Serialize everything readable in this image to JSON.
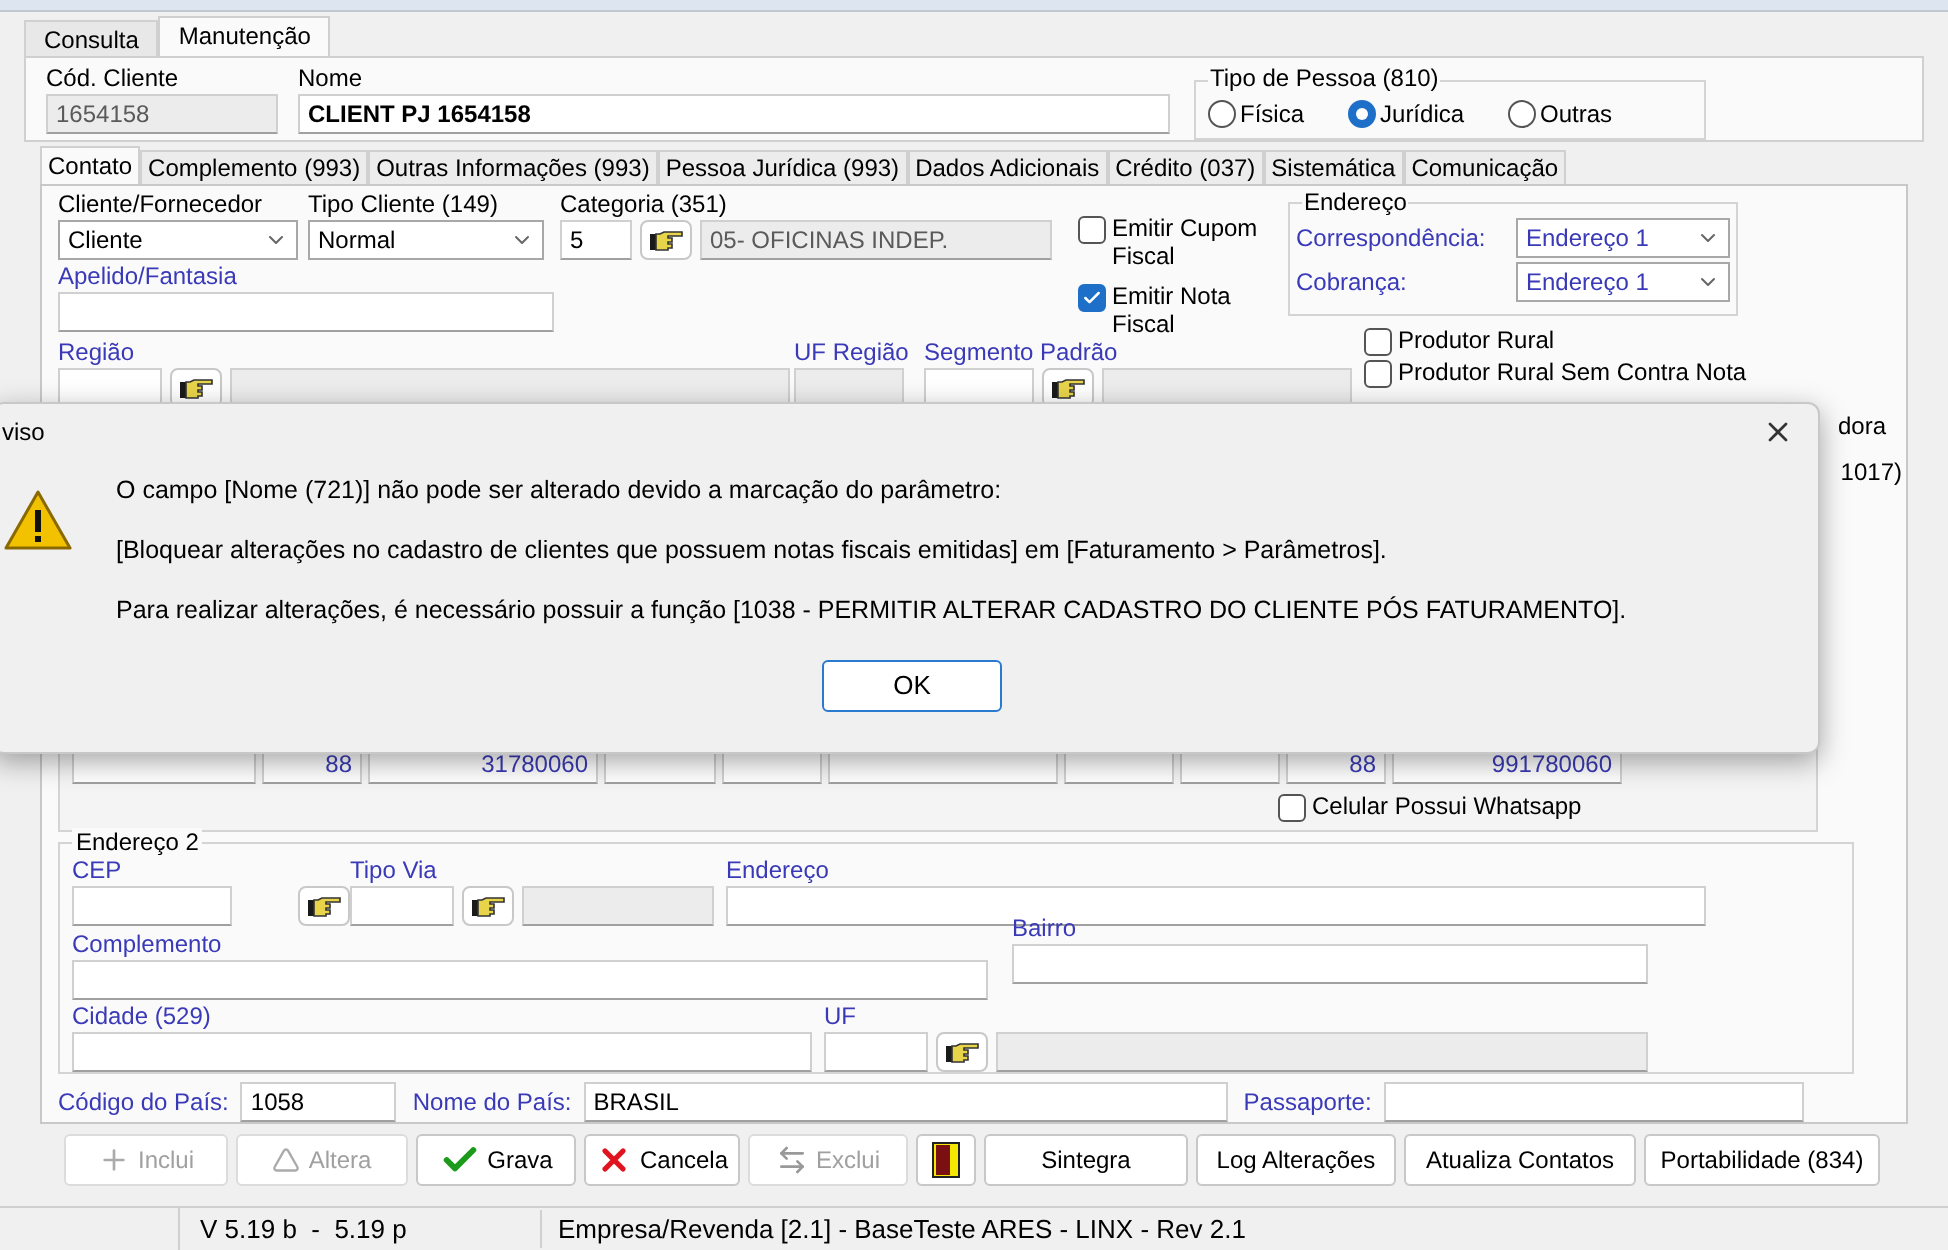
{
  "window_tabs": [
    {
      "label": "Consulta",
      "selected": false
    },
    {
      "label": "Manutenção",
      "selected": true
    }
  ],
  "header": {
    "code_label": "Cód. Cliente",
    "code": {
      "value": "1654158",
      "disabled": true
    },
    "name_label": "Nome",
    "name": {
      "value": "CLIENT PJ 1654158",
      "disabled": false
    },
    "person_type": {
      "title": "Tipo de Pessoa (810)",
      "options": [
        {
          "label": "Física",
          "selected": false
        },
        {
          "label": "Jurídica",
          "selected": true
        },
        {
          "label": "Outras",
          "selected": false
        }
      ]
    }
  },
  "tabs": [
    {
      "label": "Contato",
      "selected": true
    },
    {
      "label": "Complemento (993)",
      "selected": false
    },
    {
      "label": "Outras Informações (993)",
      "selected": false
    },
    {
      "label": "Pessoa Jurídica (993)",
      "selected": false
    },
    {
      "label": "Dados Adicionais",
      "selected": false
    },
    {
      "label": "Crédito (037)",
      "selected": false
    },
    {
      "label": "Sistemática",
      "selected": false
    },
    {
      "label": "Comunicação",
      "selected": false
    }
  ],
  "contact": {
    "client_supplier": {
      "label": "Cliente/Fornecedor",
      "value": "Cliente"
    },
    "client_type": {
      "label": "Tipo Cliente (149)",
      "value": "Normal"
    },
    "category": {
      "label": "Categoria (351)",
      "code": "5",
      "description": "05- OFICINAS INDEP."
    },
    "checks_top": [
      {
        "label": "Emitir Cupom Fiscal",
        "checked": false
      },
      {
        "label": "Emitir Nota Fiscal",
        "checked": true
      }
    ],
    "address_group": {
      "title": "Endereço",
      "rows": [
        {
          "label": "Correspondência:",
          "value": "Endereço 1"
        },
        {
          "label": "Cobrança:",
          "value": "Endereço 1"
        }
      ]
    },
    "nickname": {
      "label": "Apelido/Fantasia"
    },
    "region": {
      "label": "Região"
    },
    "uf_region": {
      "label": "UF Região"
    },
    "segment": {
      "label": "Segmento Padrão"
    },
    "checks_right": [
      {
        "label": "Produtor Rural",
        "checked": false
      },
      {
        "label": "Produtor Rural Sem Contra Nota",
        "checked": false
      }
    ],
    "covered_texts": [
      "dora",
      "1017)"
    ],
    "phones": {
      "area_code": "88",
      "number": "31780060",
      "cell_area_code": "88",
      "cell_number": "991780060",
      "whatsapp": {
        "label": "Celular Possui Whatsapp",
        "checked": false
      }
    },
    "address2": {
      "title": "Endereço 2",
      "cep": "CEP",
      "street_type": "Tipo Via",
      "street": "Endereço",
      "complement": "Complemento",
      "district": "Bairro",
      "city": "Cidade (529)",
      "uf": "UF"
    },
    "country": {
      "code_label": "Código do País:",
      "code": "1058",
      "name_label": "Nome do País:",
      "name": "BRASIL",
      "passport_label": "Passaporte:"
    }
  },
  "buttons": [
    {
      "kind": "add",
      "label": "Inclui",
      "disabled": true
    },
    {
      "kind": "edit",
      "label": "Altera",
      "disabled": true
    },
    {
      "kind": "save",
      "label": "Grava",
      "disabled": false
    },
    {
      "kind": "cancel",
      "label": "Cancela",
      "disabled": false
    },
    {
      "kind": "delete",
      "label": "Exclui",
      "disabled": true
    },
    {
      "kind": "exit",
      "disabled": false
    },
    {
      "kind": "text",
      "label": "Sintegra",
      "disabled": false
    },
    {
      "kind": "text",
      "label": "Log Alterações",
      "disabled": false
    },
    {
      "kind": "text",
      "label": "Atualiza Contatos",
      "disabled": false
    },
    {
      "kind": "text",
      "label": "Portabilidade (834)",
      "disabled": false
    }
  ],
  "status_bar": [
    "V 5.19 b  -  5.19 p",
    "Empresa/Revenda [2.1] - BaseTeste ARES - LINX - Rev 2.1"
  ],
  "dialog": {
    "title": "viso",
    "lines": [
      "O campo [Nome (721)] não pode ser alterado devido a marcação do parâmetro:",
      "[Bloquear alterações no cadastro de clientes que possuem notas fiscais emitidas] em [Faturamento > Parâmetros].",
      "Para realizar alterações, é necessário possuir a função [1038 - PERMITIR ALTERAR CADASTRO DO CLIENTE PÓS FATURAMENTO]."
    ],
    "ok": "OK"
  }
}
